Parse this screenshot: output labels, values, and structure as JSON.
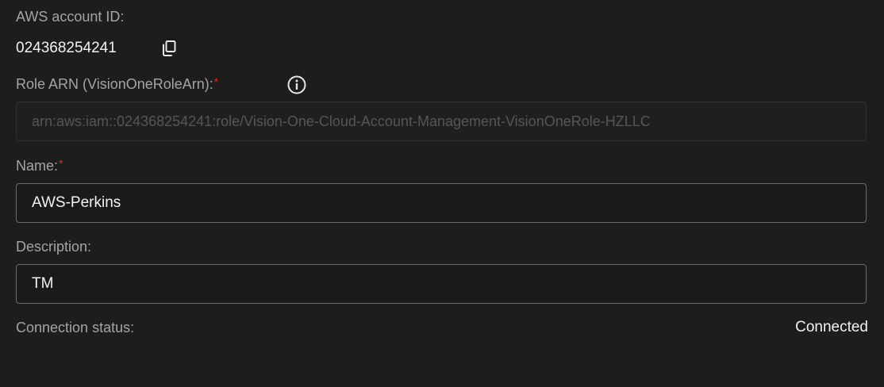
{
  "account": {
    "label": "AWS account ID:",
    "value": "024368254241",
    "copy_icon": "copy-icon"
  },
  "role_arn": {
    "label": "Role ARN (VisionOneRoleArn):",
    "required_mark": "*",
    "info_icon": "info-icon",
    "value": "arn:aws:iam::024368254241:role/Vision-One-Cloud-Account-Management-VisionOneRole-HZLLC"
  },
  "name": {
    "label": "Name:",
    "required_mark": "*",
    "value": "AWS-Perkins"
  },
  "description": {
    "label": "Description:",
    "value": "TM"
  },
  "connection": {
    "label": "Connection status:",
    "value": "Connected"
  },
  "colors": {
    "background": "#1d1d1e",
    "label": "#a4a4a4",
    "value": "#f2f2f2",
    "required": "#e0281e",
    "field_border": "#6a6a6b"
  }
}
